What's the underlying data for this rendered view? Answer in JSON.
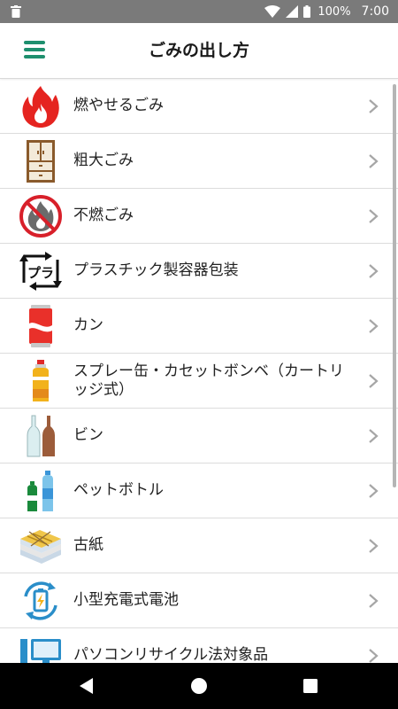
{
  "status_bar": {
    "battery_percent": "100%",
    "time": "7:00",
    "icons": [
      "trash-notification-icon",
      "wifi-icon",
      "cellular-signal-icon",
      "battery-icon"
    ]
  },
  "app_bar": {
    "title": "ごみの出し方",
    "menu_icon": "hamburger-menu-icon",
    "accent_color": "#1e8f6e"
  },
  "categories": [
    {
      "label": "燃やせるごみ",
      "icon": "fire-icon"
    },
    {
      "label": "粗大ごみ",
      "icon": "cabinet-icon"
    },
    {
      "label": "不燃ごみ",
      "icon": "no-fire-icon"
    },
    {
      "label": "プラスチック製容器包装",
      "icon": "plastic-recycle-icon"
    },
    {
      "label": "カン",
      "icon": "can-icon"
    },
    {
      "label": "スプレー缶・カセットボンベ（カートリッジ式）",
      "icon": "spray-can-icon"
    },
    {
      "label": "ビン",
      "icon": "bottles-icon"
    },
    {
      "label": "ペットボトル",
      "icon": "pet-bottle-icon"
    },
    {
      "label": "古紙",
      "icon": "old-paper-icon"
    },
    {
      "label": "小型充電式電池",
      "icon": "rechargeable-battery-icon"
    },
    {
      "label": "パソコンリサイクル法対象品",
      "icon": "computer-icon"
    }
  ],
  "nav_bar": {
    "buttons": [
      "back-icon",
      "home-icon",
      "recents-icon"
    ]
  }
}
